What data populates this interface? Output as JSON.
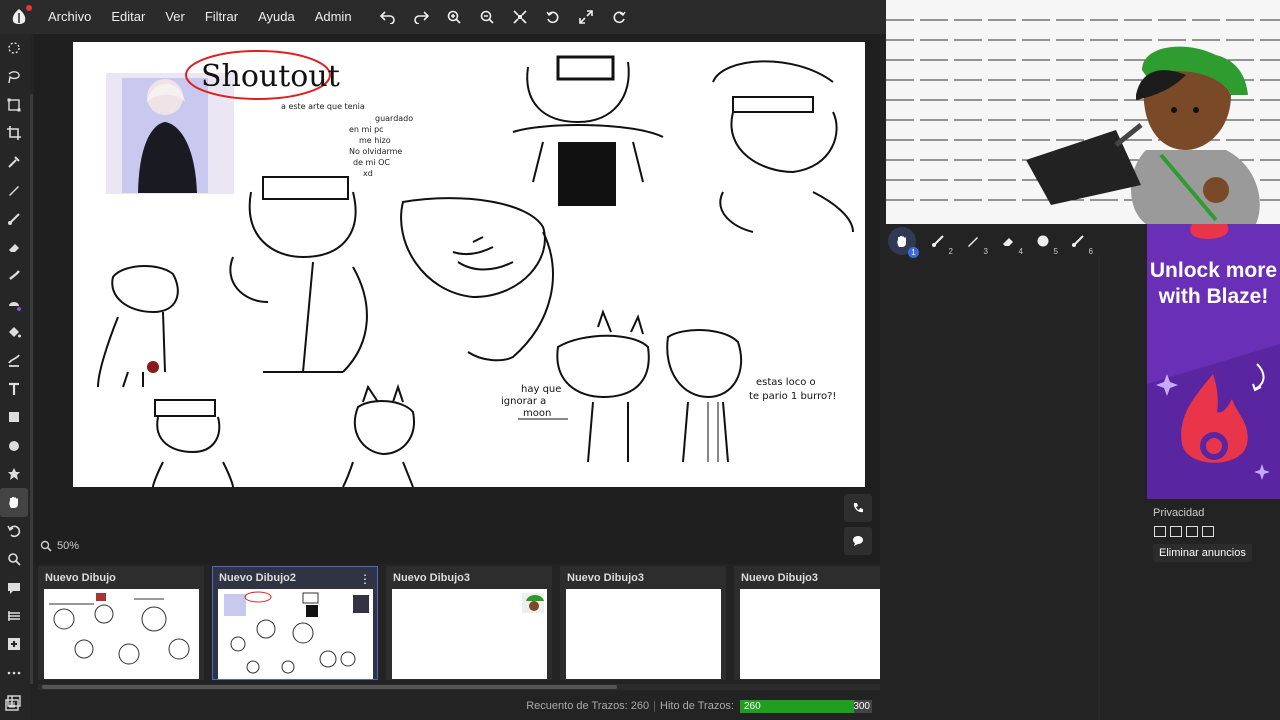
{
  "menu": {
    "items": [
      "Archivo",
      "Editar",
      "Ver",
      "Filtrar",
      "Ayuda",
      "Admin"
    ]
  },
  "top_tools": [
    "undo-icon",
    "redo-icon",
    "zoom-in-icon",
    "zoom-out-icon",
    "fit-icon",
    "rotate-left-icon",
    "fullscreen-icon",
    "rotate-right-icon"
  ],
  "left_tools": [
    "lasso-select-icon",
    "lasso-icon",
    "transform-icon",
    "crop-icon",
    "eyedropper-icon",
    "pen-icon",
    "brush-icon",
    "eraser-icon",
    "smudge-icon",
    "blend-icon",
    "fill-icon",
    "gradient-icon",
    "text-icon",
    "rectangle-icon",
    "ellipse-icon",
    "shape-icon",
    "hand-icon",
    "undo-icon",
    "zoom-icon",
    "chat-icon",
    "layers-icon",
    "add-icon",
    "more-icon",
    "panel-icon"
  ],
  "canvas": {
    "zoom_label": "50%",
    "text_shoutout": "Shoutout",
    "note_lines": [
      "a este arte que tenia",
      "guardado",
      "en mi pc",
      "me hizo",
      "No olvidarme",
      "de mi OC",
      "xd"
    ],
    "note_moon": [
      "hay que",
      "ignorar a",
      "moon"
    ],
    "note_burro": [
      "estas loco o",
      "te pario 1 burro?!"
    ]
  },
  "drawings": [
    {
      "title": "Nuevo Dibujo"
    },
    {
      "title": "Nuevo Dibujo2",
      "active": true
    },
    {
      "title": "Nuevo Dibujo3"
    },
    {
      "title": "Nuevo Dibujo3"
    },
    {
      "title": "Nuevo Dibujo3"
    }
  ],
  "status": {
    "stroke_count_label": "Recuento de Trazos: 260",
    "stroke_goal_label": "Hito de Trazos:",
    "stroke_current": "260",
    "stroke_goal": "300",
    "progress": 0.8667
  },
  "brushes": [
    {
      "icon": "hand-icon",
      "num": "1"
    },
    {
      "icon": "brush-icon",
      "num": "2"
    },
    {
      "icon": "pen-icon",
      "num": "3"
    },
    {
      "icon": "eraser-icon",
      "num": "4"
    },
    {
      "icon": "circle-icon",
      "num": "5"
    },
    {
      "icon": "brush-icon",
      "num": "6"
    }
  ],
  "ad": {
    "text": "Unlock more with Blaze!"
  },
  "privacy": {
    "label": "Privacidad",
    "remove_ads": "Eliminar anuncios"
  },
  "colors": {
    "accent": "#4b67c9",
    "progress_fill": "#1f9e1f",
    "ad_bg": "#6a2fb7",
    "shoutout_ring": "#e02020"
  }
}
